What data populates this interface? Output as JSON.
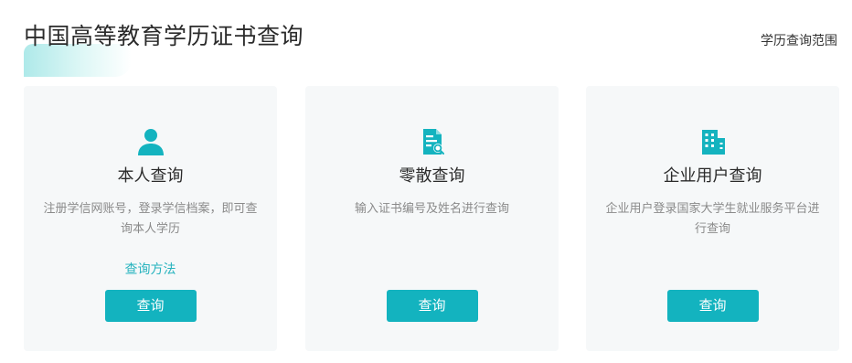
{
  "header": {
    "title": "中国高等教育学历证书查询",
    "scope_link": "学历查询范围"
  },
  "colors": {
    "accent": "#13b3bf",
    "link": "#27b3be",
    "card_bg": "#f6f8f9"
  },
  "cards": [
    {
      "icon": "person-icon",
      "title": "本人查询",
      "description": "注册学信网账号，登录学信档案，即可查询本人学历",
      "link": "查询方法",
      "button": "查询"
    },
    {
      "icon": "document-search-icon",
      "title": "零散查询",
      "description": "输入证书编号及姓名进行查询",
      "button": "查询"
    },
    {
      "icon": "building-icon",
      "title": "企业用户查询",
      "description": "企业用户登录国家大学生就业服务平台进行查询",
      "button": "查询"
    }
  ]
}
